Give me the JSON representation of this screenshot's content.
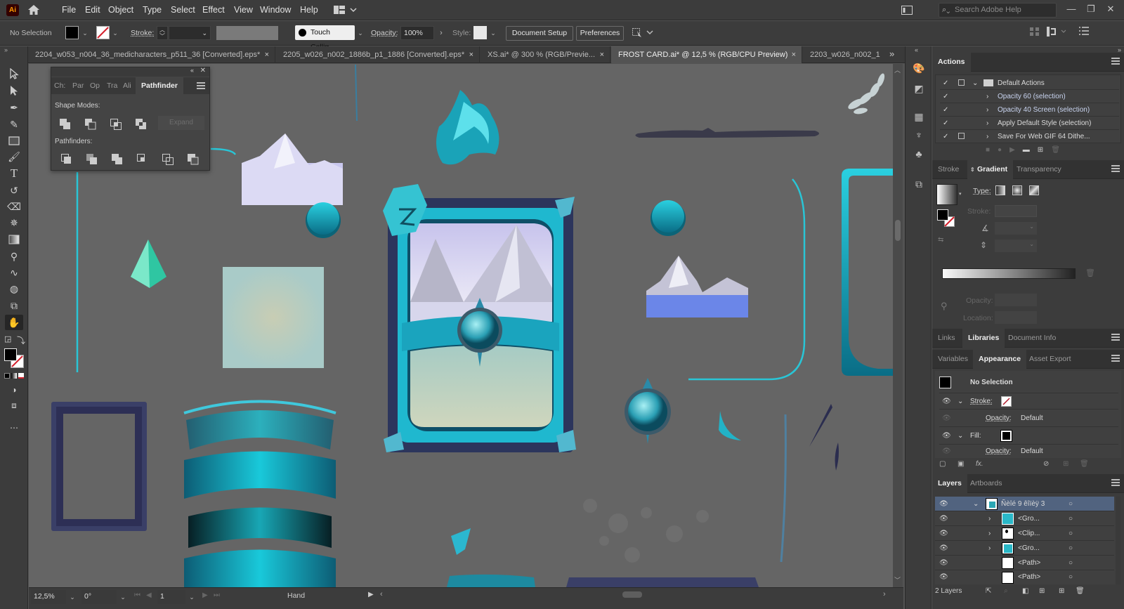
{
  "app": {
    "logo": "Ai",
    "accent": "#ff9a00"
  },
  "menu": [
    "File",
    "Edit",
    "Object",
    "Type",
    "Select",
    "Effect",
    "View",
    "Window",
    "Help"
  ],
  "search": {
    "placeholder": "Search Adobe Help"
  },
  "control_bar": {
    "selection": "No Selection",
    "stroke_label": "Stroke:",
    "brush": "Touch Callig...",
    "opacity_label": "Opacity:",
    "opacity_value": "100%",
    "style_label": "Style:",
    "document_setup": "Document Setup",
    "preferences": "Preferences"
  },
  "doc_tabs": [
    {
      "label": "2204_w053_n004_36_medicharacters_p511_36 [Converted].eps*",
      "active": false
    },
    {
      "label": "2205_w026_n002_1886b_p1_1886 [Converted].eps*",
      "active": false
    },
    {
      "label": "XS.ai* @ 300 % (RGB/Previe...",
      "active": false
    },
    {
      "label": "FROST CARD.ai* @ 12,5 % (RGB/CPU Preview)",
      "active": true
    },
    {
      "label": "2203_w026_n002_1",
      "active": false
    }
  ],
  "pathfinder_panel": {
    "tabs": [
      "Ch:",
      "Par",
      "Op",
      "Tra",
      "Ali",
      "Pathfinder"
    ],
    "shape_modes_label": "Shape Modes:",
    "expand_label": "Expand",
    "pathfinders_label": "Pathfinders:"
  },
  "actions_panel": {
    "tab": "Actions",
    "set": "Default Actions",
    "items": [
      "Opacity 60 (selection)",
      "Opacity 40 Screen (selection)",
      "Apply Default Style (selection)",
      "Save For Web GIF 64 Dithe..."
    ]
  },
  "gradient_panel": {
    "tabs": [
      "Stroke",
      "Gradient",
      "Transparency"
    ],
    "type_label": "Type:",
    "stroke_label": "Stroke:",
    "opacity_label": "Opacity:",
    "location_label": "Location:"
  },
  "libraries_tabs": [
    "Links",
    "Libraries",
    "Document Info"
  ],
  "appearance_panel": {
    "tabs": [
      "Variables",
      "Appearance",
      "Asset Export"
    ],
    "title": "No Selection",
    "stroke_label": "Stroke:",
    "fill_label": "Fill:",
    "opacity_label": "Opacity:",
    "opacity_value": "Default"
  },
  "layers_panel": {
    "tabs": [
      "Layers",
      "Artboards"
    ],
    "layer_name": "Ñèîé 9 êîïèÿ 3",
    "items": [
      "<Gro...",
      "<Clip...",
      "<Gro...",
      "<Path>",
      "<Path>"
    ],
    "count": "2 Layers"
  },
  "status_bar": {
    "zoom": "12,5%",
    "rotation": "0°",
    "artboard": "1",
    "tool": "Hand"
  }
}
